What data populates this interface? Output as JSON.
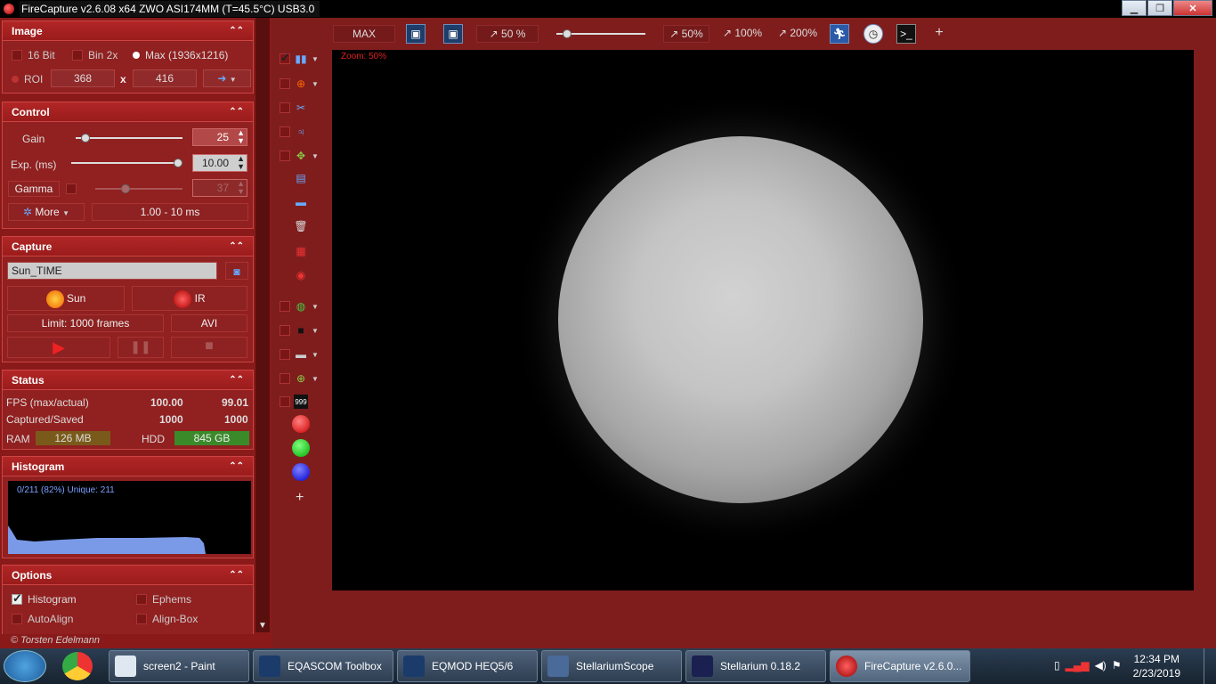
{
  "window": {
    "title": "FireCapture v2.6.08  x64     ZWO ASI174MM (T=45.5°C) USB3.0",
    "min": "▁",
    "max": "❐",
    "close": "✕"
  },
  "image_panel": {
    "title": "Image",
    "bit16": "16 Bit",
    "bin2x": "Bin 2x",
    "max": "Max (1936x1216)",
    "roi": "ROI",
    "roi_w": "368",
    "roi_x": "x",
    "roi_h": "416",
    "arrow": "➜"
  },
  "control_panel": {
    "title": "Control",
    "gain_label": "Gain",
    "gain_value": "25",
    "gain_level": 0.05,
    "exp_label": "Exp. (ms)",
    "exp_value": "10.00",
    "exp_level": 1.0,
    "gamma_label": "Gamma",
    "gamma_value": "37",
    "gamma_level": 0.33,
    "more": "More",
    "range": "1.00 - 10 ms"
  },
  "capture_panel": {
    "title": "Capture",
    "profile": "Sun_TIME",
    "sun": "Sun",
    "ir": "IR",
    "limit": "Limit: 1000 frames",
    "format": "AVI"
  },
  "status_panel": {
    "title": "Status",
    "fps_label": "FPS (max/actual)",
    "fps_max": "100.00",
    "fps_actual": "99.01",
    "cap_label": "Captured/Saved",
    "captured": "1000",
    "saved": "1000",
    "ram_label": "RAM",
    "ram": "126 MB",
    "hdd_label": "HDD",
    "hdd": "845 GB"
  },
  "histogram_panel": {
    "title": "Histogram",
    "info": "0/211 (82%)  Unique: 211"
  },
  "options_panel": {
    "title": "Options",
    "histogram": "Histogram",
    "ephems": "Ephems",
    "autoalign": "AutoAlign",
    "alignbox": "Align-Box"
  },
  "copyright": "© Torsten Edelmann",
  "toolbar": {
    "max": "MAX",
    "zoom": "50 %",
    "z50": "50%",
    "z100": "100%",
    "z200": "200%",
    "plus": "+"
  },
  "viewport": {
    "zoom_label": "Zoom: 50%"
  },
  "taskbar": {
    "items": [
      {
        "label": "screen2 - Paint"
      },
      {
        "label": "EQASCOM Toolbox"
      },
      {
        "label": "EQMOD HEQ5/6"
      },
      {
        "label": "StellariumScope"
      },
      {
        "label": "Stellarium 0.18.2"
      },
      {
        "label": "FireCapture v2.6.0..."
      }
    ],
    "time": "12:34 PM",
    "date": "2/23/2019"
  }
}
